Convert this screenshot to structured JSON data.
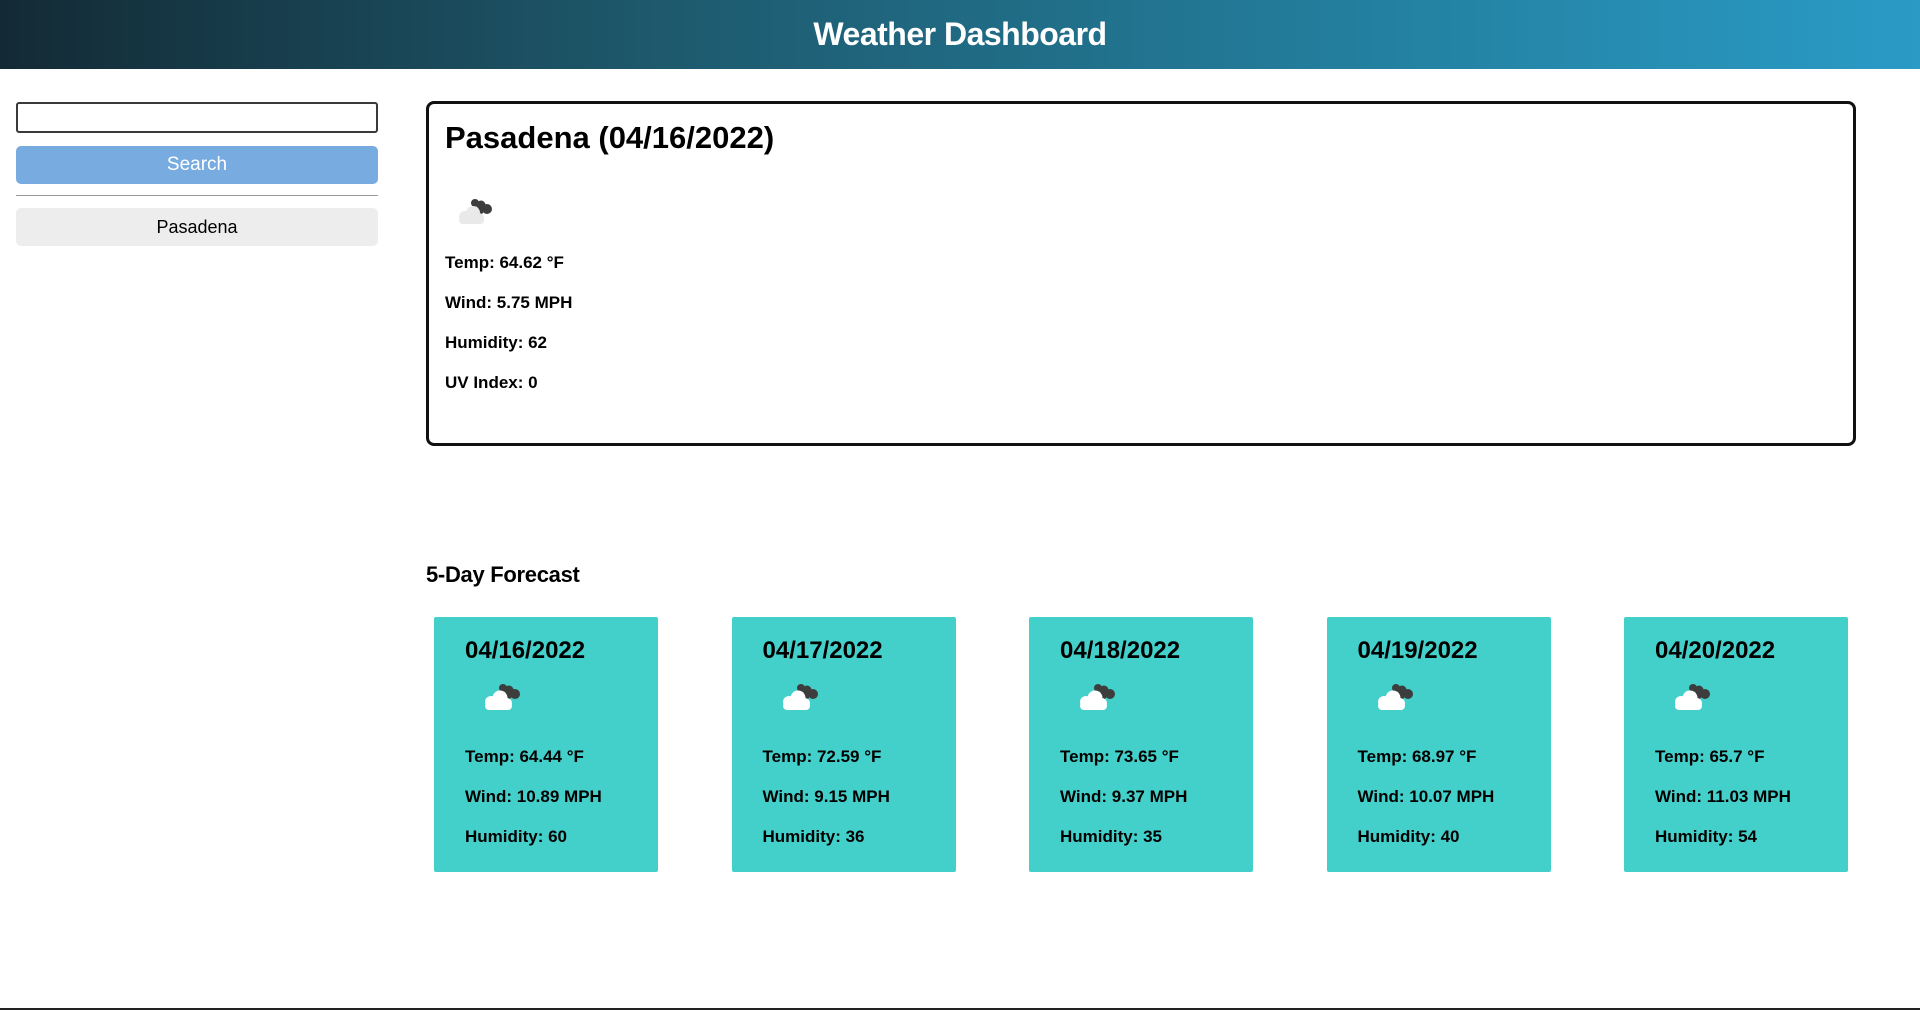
{
  "header": {
    "title": "Weather Dashboard"
  },
  "sidebar": {
    "search": {
      "value": "",
      "placeholder": ""
    },
    "search_button_label": "Search",
    "history": [
      {
        "label": "Pasadena"
      }
    ]
  },
  "current": {
    "heading": "Pasadena (04/16/2022)",
    "icon": "cloud-icon",
    "temp": "Temp: 64.62 °F",
    "wind": "Wind: 5.75 MPH",
    "humidity": "Humidity: 62",
    "uv": "UV Index: 0"
  },
  "forecast": {
    "title": "5-Day Forecast",
    "days": [
      {
        "date": "04/16/2022",
        "icon": "cloud-icon",
        "temp": "Temp: 64.44 °F",
        "wind": "Wind: 10.89 MPH",
        "humidity": "Humidity: 60"
      },
      {
        "date": "04/17/2022",
        "icon": "cloud-icon",
        "temp": "Temp: 72.59 °F",
        "wind": "Wind: 9.15 MPH",
        "humidity": "Humidity: 36"
      },
      {
        "date": "04/18/2022",
        "icon": "cloud-icon",
        "temp": "Temp: 73.65 °F",
        "wind": "Wind: 9.37 MPH",
        "humidity": "Humidity: 35"
      },
      {
        "date": "04/19/2022",
        "icon": "cloud-icon",
        "temp": "Temp: 68.97 °F",
        "wind": "Wind: 10.07 MPH",
        "humidity": "Humidity: 40"
      },
      {
        "date": "04/20/2022",
        "icon": "cloud-icon",
        "temp": "Temp: 65.7 °F",
        "wind": "Wind: 11.03 MPH",
        "humidity": "Humidity: 54"
      }
    ]
  },
  "colors": {
    "header_start": "#132a35",
    "header_end": "#2a9bc6",
    "search_button": "#78ace1",
    "history_button": "#ededed",
    "forecast_card": "#44d0ca"
  }
}
